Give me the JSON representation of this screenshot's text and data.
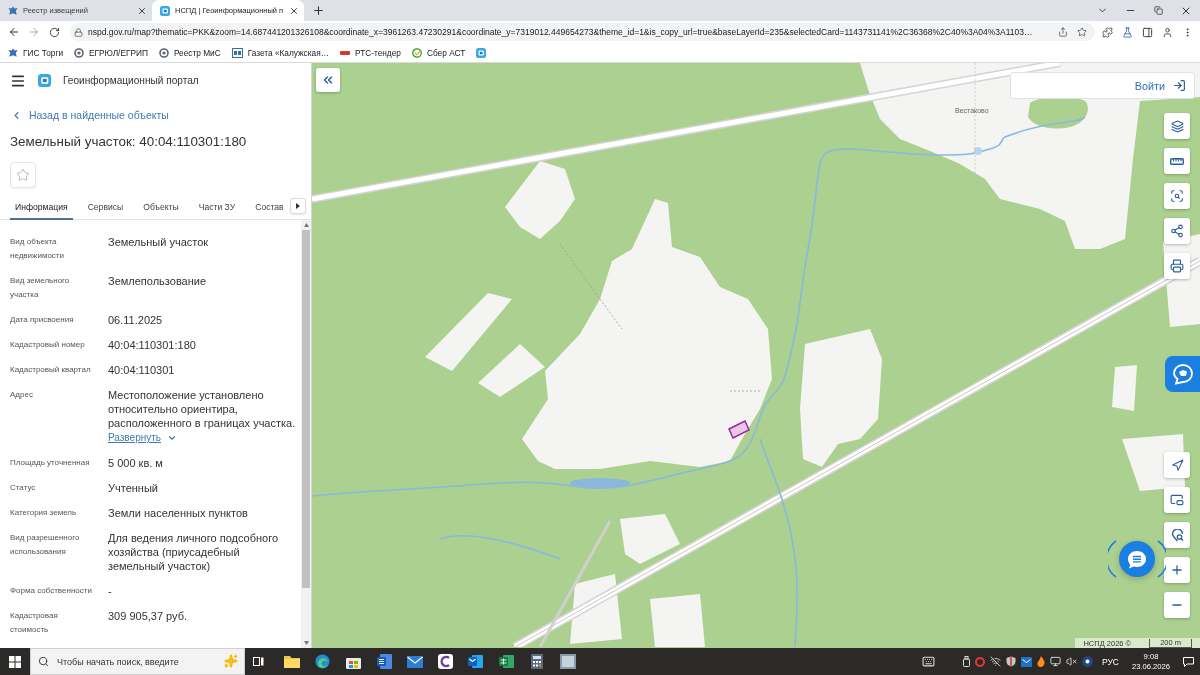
{
  "browser": {
    "tabs": [
      {
        "title": "Реестр извещений",
        "selected": false
      },
      {
        "title": "НСПД | Геоинформационный п",
        "selected": true
      }
    ],
    "address": "nspd.gov.ru/map?thematic=PKK&zoom=14.687441201326108&coordinate_x=3961263.47230291&coordinate_y=7319012.449654273&theme_id=1&is_copy_url=true&baseLayerId=235&selectedCard=1143731141%2C36368%2C40%3A04%3A1103…",
    "bookmarks": [
      "ГИС Торги",
      "ЕГРЮЛ/ЕГРИП",
      "Реестр МиС",
      "Газета «Калужская…",
      "РТС-тендер",
      "Сбер АСТ"
    ]
  },
  "portal": {
    "title": "Геоинформационный портал"
  },
  "panel": {
    "back_link": "Назад в найденные объекты",
    "heading": "Земельный участок: 40:04:110301:180",
    "favorite": false,
    "tabs": [
      {
        "label": "Информация",
        "selected": true
      },
      {
        "label": "Сервисы",
        "selected": false
      },
      {
        "label": "Объекты",
        "selected": false
      },
      {
        "label": "Части ЗУ",
        "selected": false
      },
      {
        "label": "Состав",
        "selected": false
      }
    ],
    "properties": [
      {
        "label": "Вид объекта недвижимости",
        "value": "Земельный участок"
      },
      {
        "label": "Вид земельного участка",
        "value": "Землепользование"
      },
      {
        "label": "Дата присвоения",
        "value": "06.11.2025"
      },
      {
        "label": "Кадастровый номер",
        "value": "40:04:110301:180"
      },
      {
        "label": "Кадастровый квартал",
        "value": "40:04:110301"
      },
      {
        "label": "Адрес",
        "value": "Местоположение установлено относительно ориентира, расположенного в границах участка.",
        "expand_link": "Развернуть"
      },
      {
        "label": "Площадь уточненная",
        "value": "5 000 кв. м"
      },
      {
        "label": "Статус",
        "value": "Учтенный"
      },
      {
        "label": "Категория земель",
        "value": "Земли населенных пунктов"
      },
      {
        "label": "Вид разрешенного использования",
        "value": "Для ведения личного подсобного хозяйства (приусадебный земельный участок)"
      },
      {
        "label": "Форма собственности",
        "value": "-"
      },
      {
        "label": "Кадастровая стоимость",
        "value": "309 905,37 руб."
      }
    ]
  },
  "map": {
    "place_label": "Вестаково",
    "login": "Войти",
    "attribution": "НСПД 2026 ©",
    "scale": "200 m"
  },
  "taskbar": {
    "search_placeholder": "Чтобы начать поиск, введите",
    "language": "РУС",
    "time": "9:08",
    "date": "23.06.2026"
  }
}
